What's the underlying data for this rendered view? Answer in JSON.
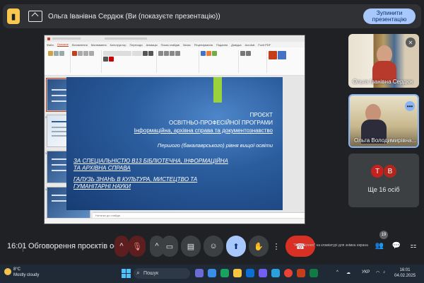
{
  "banner": {
    "text": "Ольга Іванівна Сердюк (Ви (показуєте презентацію))",
    "stop_label": "Зупинити презентацію"
  },
  "ppt": {
    "menu": [
      "Файл",
      "Основне",
      "Вставлення",
      "Малювання",
      "Конструктор",
      "Переходи",
      "Анімація",
      "Показ слайдів",
      "Запис",
      "Рецензування",
      "Подання",
      "Довідка",
      "Acrobat",
      "Foxit PDF"
    ],
    "active_menu": "Основне",
    "notes_placeholder": "Нотатки до слайда",
    "slide_numbers": [
      "1",
      "2",
      "3",
      "4"
    ]
  },
  "slide": {
    "line1": "ПРОЄКТ",
    "line2": "ОСВІТНЬО-ПРОФЕСІЙНОЇ ПРОГРАМИ",
    "line3": "Інформаційна, архівна справа та документознавство",
    "line4": "Першого (бакалаврського) рівня вищої освіти",
    "line5": "ЗА СПЕЦІАЛЬНІСТЮ В13 БІБЛІОТЕЧНА, ІНФОРМАЦІЙНА",
    "line6": "ТА АРХІВНА СПРАВА",
    "line7": "ГАЛУЗЬ ЗНАНЬ В КУЛЬТУРА, МИСТЕЦТВО ТА",
    "line8": "ГУМАНІТАРНІ НАУКИ"
  },
  "participants": [
    {
      "name": "Ольга Іванівна Сердюк"
    },
    {
      "name": "Ольга Володимирівна..."
    }
  ],
  "others": {
    "initials": [
      "Т",
      "В"
    ],
    "label": "Ще 16 осіб"
  },
  "meeting": {
    "time": "16:01",
    "title": "Обговорення проєктів осві...",
    "participants_count": "19"
  },
  "toast": {
    "text": "\"Print Screen\" на клавіатурі для знімка екрана"
  },
  "taskbar": {
    "weather_temp": "8°C",
    "weather_desc": "Mostly cloudy",
    "search_placeholder": "Пошук",
    "lang": "УКР",
    "time": "16:01",
    "date": "04.02.2025"
  },
  "colors": {
    "accent_blue": "#a8c7fa",
    "end_call_red": "#d93025",
    "slide_accent": "#9bd13a"
  }
}
